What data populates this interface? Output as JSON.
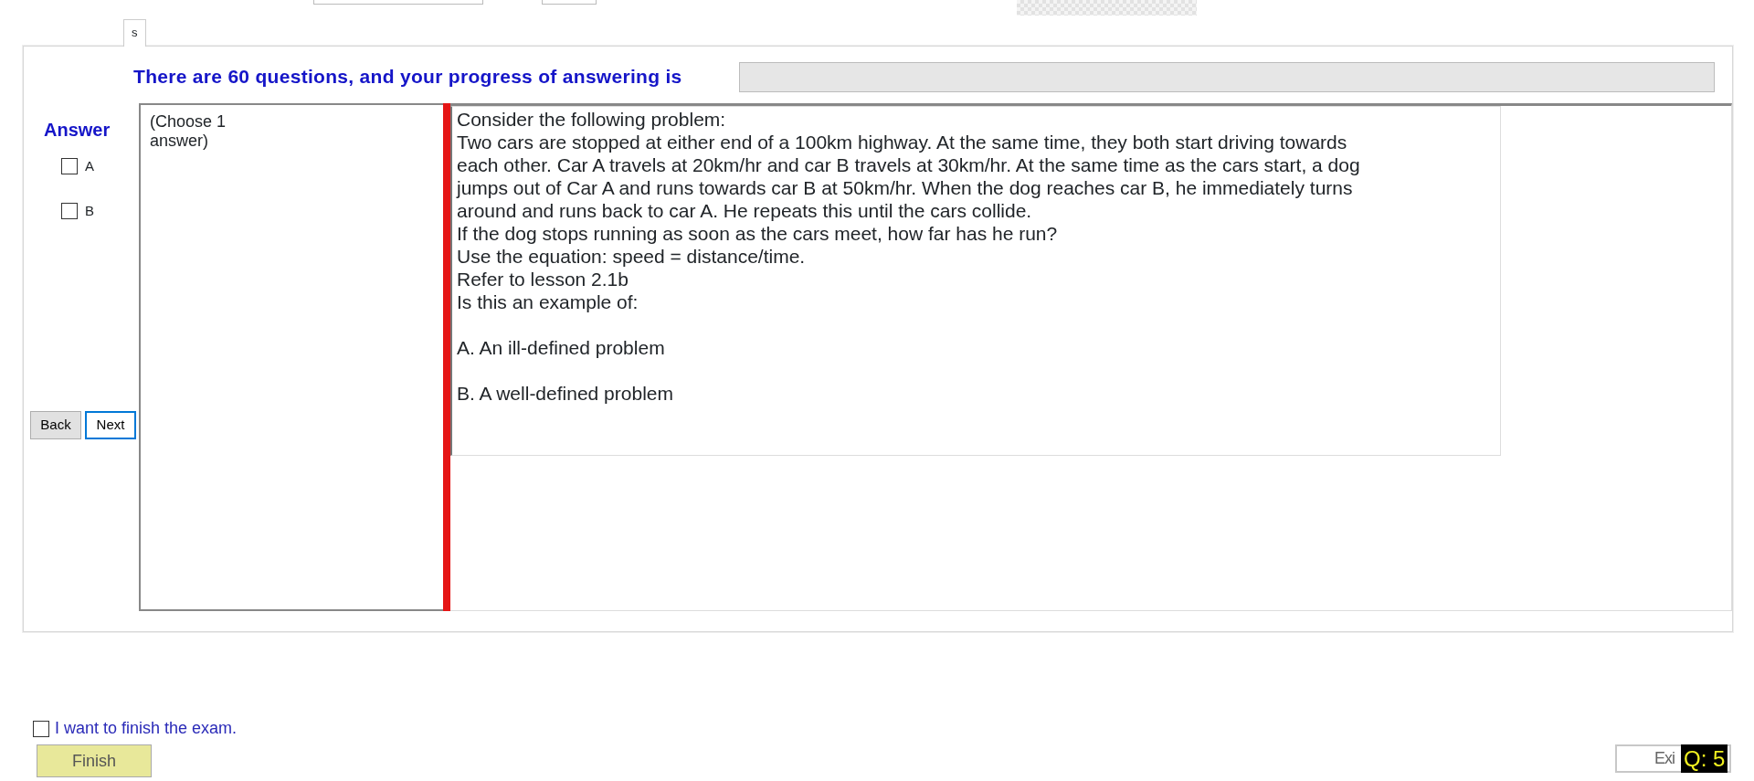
{
  "tab": {
    "label": "s",
    "selected": true
  },
  "progress": {
    "label": "There are 60 questions, and your progress of answering is",
    "level": 0
  },
  "answer": {
    "title": "Answer",
    "options": [
      {
        "label": "A",
        "checked": false
      },
      {
        "label": "B",
        "checked": false
      }
    ]
  },
  "nav_buttons": [
    {
      "label": "Back",
      "focused": false
    },
    {
      "label": "Next",
      "focused": true
    }
  ],
  "instruction": "(Choose 1 answer)",
  "question": {
    "lines": [
      "Consider the following problem:",
      "Two cars are stopped at either end of a 100km highway. At the same time, they both start driving towards",
      "each other. Car A travels at 20km/hr and car B travels at 30km/hr. At the same time as the cars start, a dog",
      "jumps out of Car A and runs towards car B at 50km/hr. When the dog reaches car B, he immediately turns",
      "around and runs back to car A. He repeats this until the cars collide.",
      "If the dog stops running as soon as the cars meet, how far has he run?",
      "Use the equation: speed = distance/time.",
      "Refer to lesson 2.1b",
      "Is this an example of:"
    ],
    "choices": [
      "A.  An ill-defined problem",
      "B.  A well-defined problem"
    ]
  },
  "finish": {
    "checkbox_label": "I want to finish the exam.",
    "checked": false,
    "button": "Finish"
  },
  "exit_button": "Exi",
  "question_number": "Q: 5"
}
